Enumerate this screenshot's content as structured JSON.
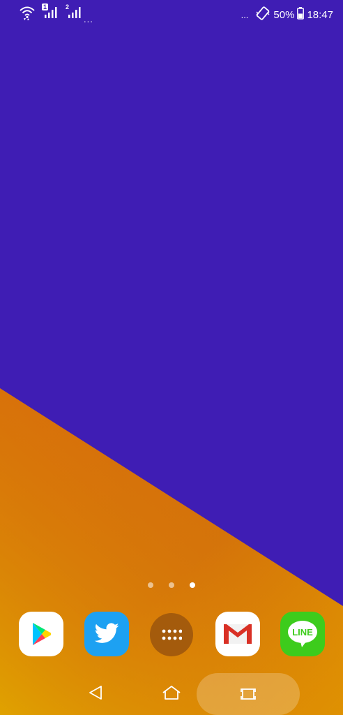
{
  "status_bar": {
    "sim1_label": "1",
    "sim2_label": "2",
    "notifications_more": "...",
    "more_indicator": "...",
    "battery_percent": "50%",
    "time": "18:47"
  },
  "home": {
    "page_count": 3,
    "active_page": 3
  },
  "dock": {
    "apps": [
      {
        "name": "Play Store",
        "color": "#ffffff"
      },
      {
        "name": "Twitter",
        "color": "#1da1f2"
      },
      {
        "name": "All Apps",
        "color": "#a45b0c"
      },
      {
        "name": "Gmail",
        "color": "#ffffff"
      },
      {
        "name": "LINE",
        "color": "#3dcc1c",
        "label": "LINE"
      }
    ]
  },
  "colors": {
    "wallpaper_top": "#3f1db4",
    "wallpaper_bottom_start": "#d66a0a",
    "wallpaper_bottom_end": "#e29a03"
  }
}
